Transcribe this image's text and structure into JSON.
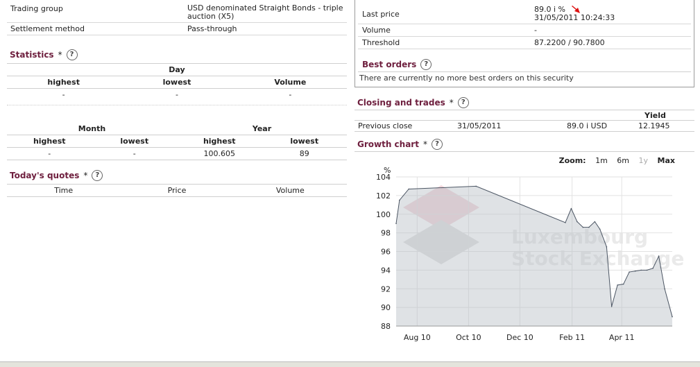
{
  "general": {
    "rows": [
      {
        "key": "Trading group",
        "value": "USD denominated Straight Bonds - triple auction (X5)"
      },
      {
        "key": "Settlement method",
        "value": "Pass-through"
      }
    ]
  },
  "statistics": {
    "title": "Statistics",
    "star": "*",
    "help": "?",
    "day_label": "Day",
    "day_headers": [
      "highest",
      "lowest",
      "Volume"
    ],
    "day_values": [
      "-",
      "-",
      "-"
    ],
    "month_label": "Month",
    "year_label": "Year",
    "my_headers": [
      "highest",
      "lowest",
      "highest",
      "lowest"
    ],
    "my_values": [
      "-",
      "-",
      "100.605",
      "89"
    ]
  },
  "quotes": {
    "title": "Today's quotes",
    "star": "*",
    "help": "?",
    "headers": [
      "Time",
      "Price",
      "Volume"
    ]
  },
  "price": {
    "last_price_label": "Last price",
    "last_price_value": "89.0 i  %",
    "last_price_time": "31/05/2011 10:24:33",
    "trend_color": "#dd1111",
    "volume_label": "Volume",
    "volume_value": "-",
    "threshold_label": "Threshold",
    "threshold_value": "87.2200 / 90.7800"
  },
  "best_orders": {
    "title": "Best orders",
    "help": "?",
    "message": "There are currently no more best orders on this security"
  },
  "closing": {
    "title": "Closing and trades",
    "star": "*",
    "help": "?",
    "yield_header": "Yield",
    "row_label": "Previous close",
    "row_date": "31/05/2011",
    "row_price": "89.0 i USD",
    "row_yield": "12.1945"
  },
  "growth": {
    "title": "Growth chart",
    "star": "*",
    "help": "?",
    "zoom_label": "Zoom:",
    "zoom_options": [
      "1m",
      "6m",
      "1y",
      "Max"
    ],
    "watermark_line1": "Luxembourg",
    "watermark_line2": "Stock Exchange"
  },
  "chart_data": {
    "type": "area",
    "ylabel": "%",
    "ylim": [
      88,
      104
    ],
    "yticks": [
      88,
      90,
      92,
      94,
      96,
      98,
      100,
      102,
      104
    ],
    "xlim": [
      "2010-07-07",
      "2011-05-31"
    ],
    "xticks": [
      {
        "label": "Aug 10",
        "date": "2010-08-01"
      },
      {
        "label": "Oct 10",
        "date": "2010-10-01"
      },
      {
        "label": "Dec 10",
        "date": "2010-12-01"
      },
      {
        "label": "Feb 11",
        "date": "2011-02-01"
      },
      {
        "label": "Apr 11",
        "date": "2011-04-01"
      }
    ],
    "grid": true,
    "series": [
      {
        "x": [
          "2010-07-07",
          "2010-07-11",
          "2010-07-22",
          "2010-10-10",
          "2011-01-24",
          "2011-01-31",
          "2011-02-07",
          "2011-02-14",
          "2011-02-21",
          "2011-02-28",
          "2011-03-06",
          "2011-03-14",
          "2011-03-20",
          "2011-03-27",
          "2011-04-03",
          "2011-04-10",
          "2011-04-17",
          "2011-04-24",
          "2011-05-01",
          "2011-05-08",
          "2011-05-15",
          "2011-05-22",
          "2011-05-31"
        ],
        "y": [
          99.0,
          101.5,
          102.7,
          103.0,
          99.1,
          100.6,
          99.2,
          98.6,
          98.6,
          99.2,
          98.4,
          96.5,
          90.1,
          92.4,
          92.5,
          93.8,
          93.9,
          94.0,
          94.0,
          94.2,
          95.5,
          92.0,
          89.0
        ]
      }
    ]
  }
}
